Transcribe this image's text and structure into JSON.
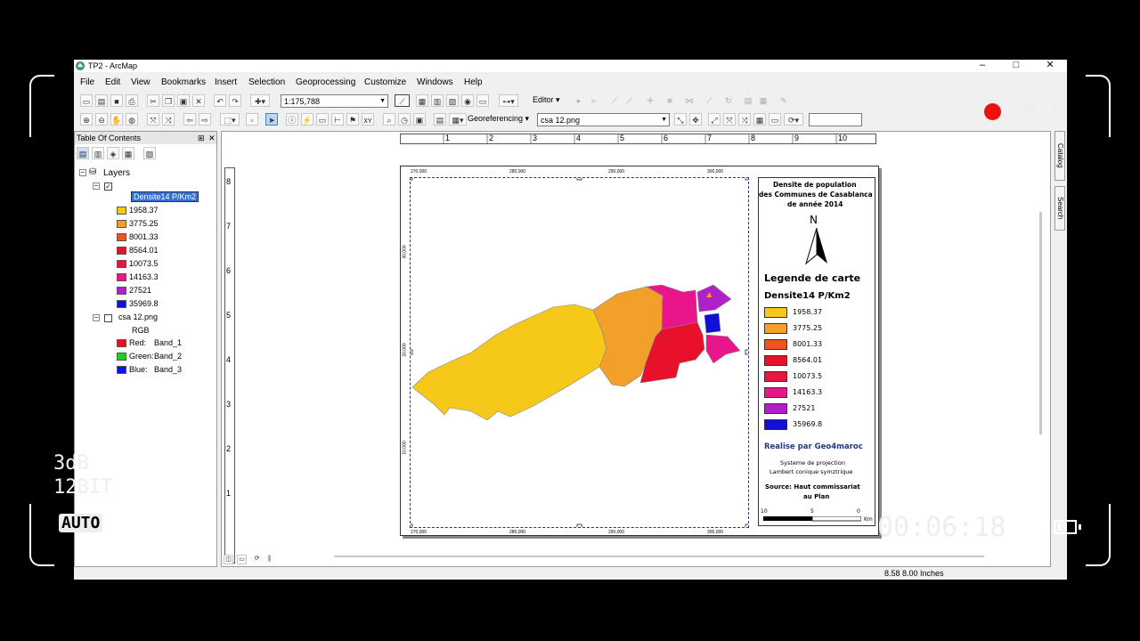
{
  "app": {
    "title": "TP2 - ArcMap",
    "win_min": "–",
    "win_max": "□",
    "win_close": "✕"
  },
  "menu": [
    "File",
    "Edit",
    "View",
    "Bookmarks",
    "Insert",
    "Selection",
    "Geoprocessing",
    "Customize",
    "Windows",
    "Help"
  ],
  "toolbar": {
    "scale_value": "1:175,788",
    "editor_label": "Editor ▾",
    "georef_label": "Georeferencing ▾",
    "georef_layer": "csa 12.png"
  },
  "toc": {
    "title": "Table Of Contents",
    "pin": "⊞",
    "close": "✕",
    "layers_label": "Layers",
    "layer1": {
      "name": "Densite14 P/Km2",
      "classes": [
        {
          "label": "1958.37",
          "color": "#f6c81a"
        },
        {
          "label": "3775.25",
          "color": "#f2a02a"
        },
        {
          "label": "8001.33",
          "color": "#ee5424"
        },
        {
          "label": "8564.01",
          "color": "#e8102a"
        },
        {
          "label": "10073.5",
          "color": "#e8153e"
        },
        {
          "label": "14163.3",
          "color": "#e8168a"
        },
        {
          "label": "27521",
          "color": "#b020c8"
        },
        {
          "label": "35969.8",
          "color": "#1010d8"
        }
      ]
    },
    "layer2": {
      "name": "csa 12.png",
      "rgb_label": "RGB",
      "bands": [
        {
          "label": "Red:",
          "band": "Band_1",
          "color": "#e8101a"
        },
        {
          "label": "Green:",
          "band": "Band_2",
          "color": "#20d020"
        },
        {
          "label": "Blue:",
          "band": "Band_3",
          "color": "#1010e0"
        }
      ]
    }
  },
  "ruler": {
    "h_numbers": [
      "1",
      "2",
      "3",
      "4",
      "5",
      "6",
      "7",
      "8",
      "9",
      "10"
    ],
    "v_numbers": [
      "8",
      "7",
      "6",
      "5",
      "4",
      "3",
      "2",
      "1"
    ]
  },
  "map": {
    "top_ticks": [
      "270,000",
      "280,000",
      "290,000",
      "300,000"
    ],
    "bottom_ticks": [
      "270,000",
      "280,000",
      "290,000",
      "300,000"
    ],
    "left_ticks": [
      "30,000",
      "20,000",
      "10,000"
    ]
  },
  "legend": {
    "title_lines": [
      "Densite de population",
      "des Communes de Casablanca",
      "de année 2014"
    ],
    "north": "N",
    "heading": "Legende de carte",
    "layer_name": "Densite14 P/Km2",
    "credit": "Realise par Geo4maroc",
    "projection_lines": [
      "Systeme de projection",
      "Lambert conique symztrique"
    ],
    "source_lines": [
      "Source: Haut commissariat",
      "au Plan"
    ],
    "scale_labels": [
      "10",
      "5",
      "0"
    ],
    "scale_unit": "Km"
  },
  "status": {
    "coords": "8.58  8.00 Inches"
  },
  "dock": {
    "catalog": "Catalog",
    "search": "Search"
  },
  "overlay": {
    "rec": "REC",
    "db": "3dB",
    "bit": "12BIT",
    "auto": "AUTO",
    "timecode": "00:06:18"
  },
  "colors": {
    "rec_dot": "#f01010",
    "selection": "#3070d0"
  }
}
